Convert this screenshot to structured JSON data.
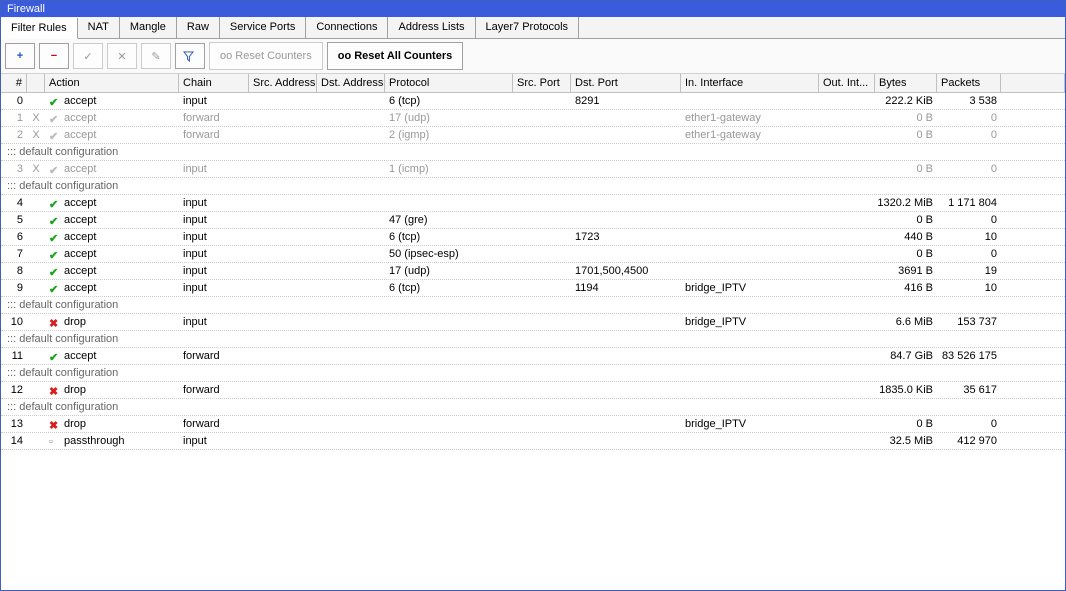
{
  "window": {
    "title": "Firewall"
  },
  "tabs": [
    {
      "id": "filter",
      "label": "Filter Rules",
      "active": true
    },
    {
      "id": "nat",
      "label": "NAT"
    },
    {
      "id": "mangle",
      "label": "Mangle"
    },
    {
      "id": "raw",
      "label": "Raw"
    },
    {
      "id": "service-ports",
      "label": "Service Ports"
    },
    {
      "id": "connections",
      "label": "Connections"
    },
    {
      "id": "address-lists",
      "label": "Address Lists"
    },
    {
      "id": "layer7",
      "label": "Layer7 Protocols"
    }
  ],
  "toolbar": {
    "add": "+",
    "remove": "−",
    "enable": "✓",
    "disable": "✕",
    "comment": "✎",
    "filter": "▼",
    "reset_counters": "oo Reset Counters",
    "reset_all_counters": "oo Reset All Counters"
  },
  "columns": {
    "num": "#",
    "action": "Action",
    "chain": "Chain",
    "src": "Src. Address",
    "dst": "Dst. Address",
    "proto": "Protocol",
    "srcport": "Src. Port",
    "dstport": "Dst. Port",
    "inif": "In. Interface",
    "outif": "Out. Int...",
    "bytes": "Bytes",
    "packets": "Packets"
  },
  "comment_text": "::: default configuration",
  "icons": {
    "accept": {
      "glyph": "✔",
      "color": "#1aa31a"
    },
    "drop": {
      "glyph": "✖",
      "color": "#d62020"
    },
    "passthrough": {
      "glyph": "▫",
      "color": "#888"
    }
  },
  "rows": [
    {
      "type": "rule",
      "num": "0",
      "flag": "",
      "disabled": false,
      "action": "accept",
      "chain": "input",
      "proto": "6 (tcp)",
      "dstport": "8291",
      "inif": "",
      "bytes": "222.2 KiB",
      "packets": "3 538"
    },
    {
      "type": "rule",
      "num": "1",
      "flag": "X",
      "disabled": true,
      "action": "accept",
      "chain": "forward",
      "proto": "17 (udp)",
      "dstport": "",
      "inif": "ether1-gateway",
      "bytes": "0 B",
      "packets": "0"
    },
    {
      "type": "rule",
      "num": "2",
      "flag": "X",
      "disabled": true,
      "action": "accept",
      "chain": "forward",
      "proto": "2 (igmp)",
      "dstport": "",
      "inif": "ether1-gateway",
      "bytes": "0 B",
      "packets": "0"
    },
    {
      "type": "comment"
    },
    {
      "type": "rule",
      "num": "3",
      "flag": "X",
      "disabled": true,
      "action": "accept",
      "chain": "input",
      "proto": "1 (icmp)",
      "dstport": "",
      "inif": "",
      "bytes": "0 B",
      "packets": "0"
    },
    {
      "type": "comment"
    },
    {
      "type": "rule",
      "num": "4",
      "flag": "",
      "disabled": false,
      "action": "accept",
      "chain": "input",
      "proto": "",
      "dstport": "",
      "inif": "",
      "bytes": "1320.2 MiB",
      "packets": "1 171 804"
    },
    {
      "type": "rule",
      "num": "5",
      "flag": "",
      "disabled": false,
      "action": "accept",
      "chain": "input",
      "proto": "47 (gre)",
      "dstport": "",
      "inif": "",
      "bytes": "0 B",
      "packets": "0"
    },
    {
      "type": "rule",
      "num": "6",
      "flag": "",
      "disabled": false,
      "action": "accept",
      "chain": "input",
      "proto": "6 (tcp)",
      "dstport": "1723",
      "inif": "",
      "bytes": "440 B",
      "packets": "10"
    },
    {
      "type": "rule",
      "num": "7",
      "flag": "",
      "disabled": false,
      "action": "accept",
      "chain": "input",
      "proto": "50 (ipsec-esp)",
      "dstport": "",
      "inif": "",
      "bytes": "0 B",
      "packets": "0"
    },
    {
      "type": "rule",
      "num": "8",
      "flag": "",
      "disabled": false,
      "action": "accept",
      "chain": "input",
      "proto": "17 (udp)",
      "dstport": "1701,500,4500",
      "inif": "",
      "bytes": "3691 B",
      "packets": "19"
    },
    {
      "type": "rule",
      "num": "9",
      "flag": "",
      "disabled": false,
      "action": "accept",
      "chain": "input",
      "proto": "6 (tcp)",
      "dstport": "1194",
      "inif": "bridge_IPTV",
      "bytes": "416 B",
      "packets": "10"
    },
    {
      "type": "comment"
    },
    {
      "type": "rule",
      "num": "10",
      "flag": "",
      "disabled": false,
      "action": "drop",
      "chain": "input",
      "proto": "",
      "dstport": "",
      "inif": "bridge_IPTV",
      "bytes": "6.6 MiB",
      "packets": "153 737"
    },
    {
      "type": "comment"
    },
    {
      "type": "rule",
      "num": "11",
      "flag": "",
      "disabled": false,
      "action": "accept",
      "chain": "forward",
      "proto": "",
      "dstport": "",
      "inif": "",
      "bytes": "84.7 GiB",
      "packets": "83 526 175"
    },
    {
      "type": "comment"
    },
    {
      "type": "rule",
      "num": "12",
      "flag": "",
      "disabled": false,
      "action": "drop",
      "chain": "forward",
      "proto": "",
      "dstport": "",
      "inif": "",
      "bytes": "1835.0 KiB",
      "packets": "35 617"
    },
    {
      "type": "comment"
    },
    {
      "type": "rule",
      "num": "13",
      "flag": "",
      "disabled": false,
      "action": "drop",
      "chain": "forward",
      "proto": "",
      "dstport": "",
      "inif": "bridge_IPTV",
      "bytes": "0 B",
      "packets": "0"
    },
    {
      "type": "rule",
      "num": "14",
      "flag": "",
      "disabled": false,
      "action": "passthrough",
      "chain": "input",
      "proto": "",
      "dstport": "",
      "inif": "",
      "bytes": "32.5 MiB",
      "packets": "412 970"
    }
  ]
}
